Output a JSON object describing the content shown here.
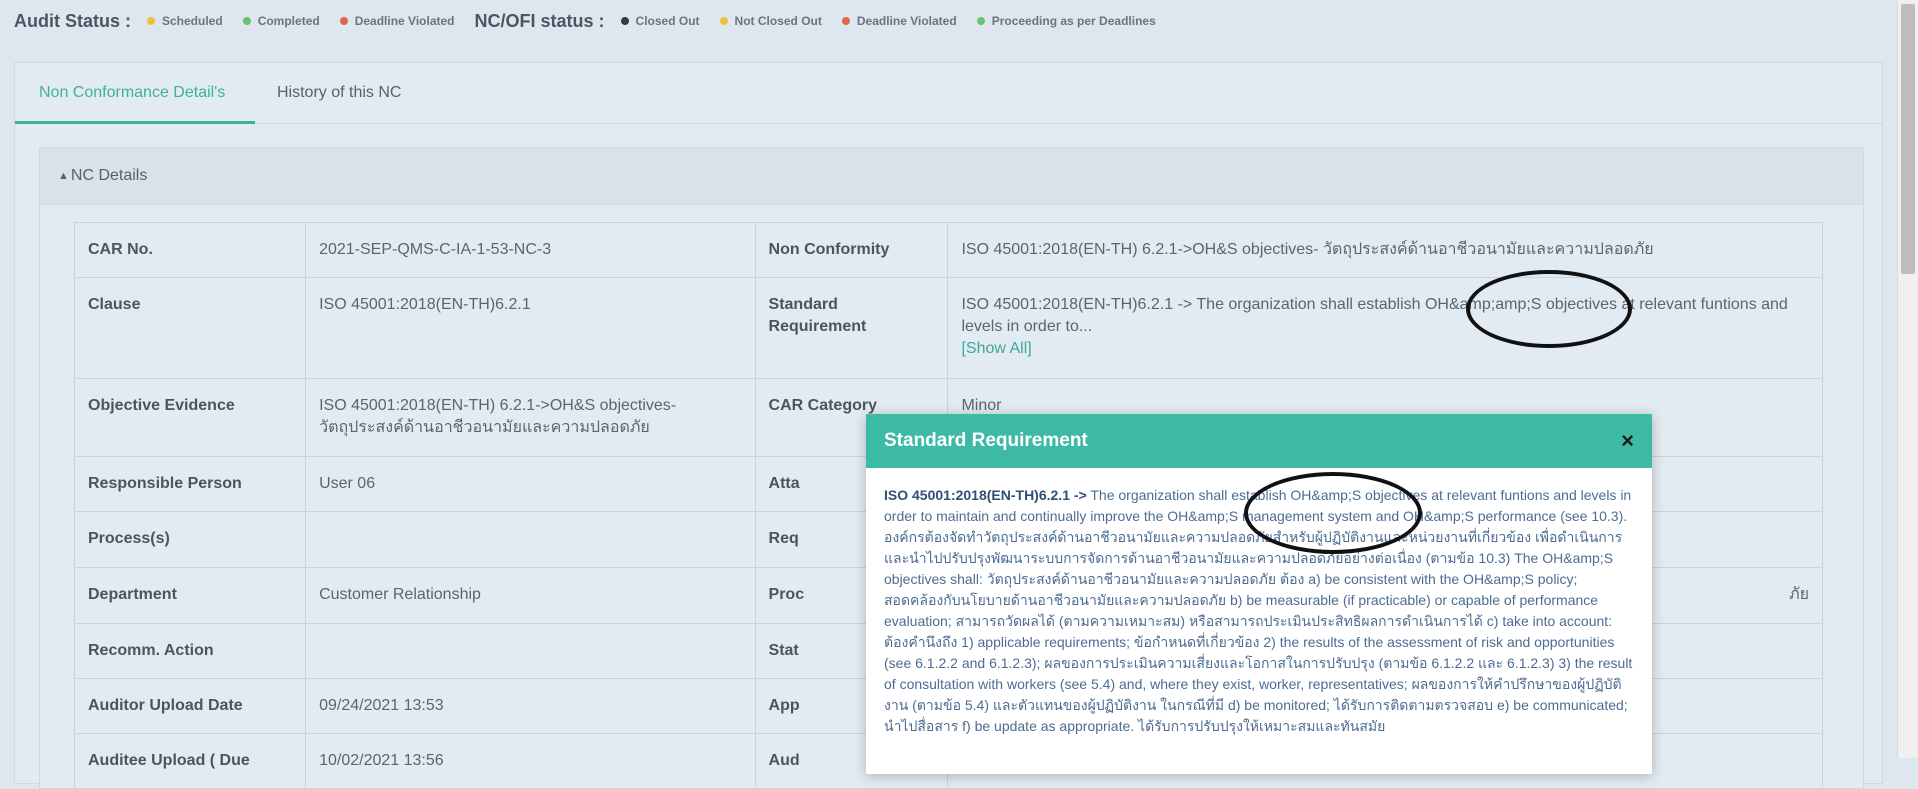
{
  "audit_status": {
    "title": "Audit Status :",
    "items": [
      {
        "label": "Scheduled",
        "color": "#e8c33a"
      },
      {
        "label": "Completed",
        "color": "#6cc071"
      },
      {
        "label": "Deadline Violated",
        "color": "#e0654a"
      }
    ]
  },
  "nc_status": {
    "title": "NC/OFI status :",
    "items": [
      {
        "label": "Closed Out",
        "color": "#333a40"
      },
      {
        "label": "Not Closed Out",
        "color": "#e8c33a"
      },
      {
        "label": "Deadline Violated",
        "color": "#e0654a"
      },
      {
        "label": "Proceeding as per Deadlines",
        "color": "#6cc071"
      }
    ]
  },
  "tabs": {
    "detail": "Non Conformance Detail's",
    "history": "History of this NC"
  },
  "nc_details": {
    "header": "NC Details",
    "rows": {
      "car_no": {
        "label": "CAR No.",
        "value": "2021-SEP-QMS-C-IA-1-53-NC-3"
      },
      "non_conformity": {
        "label": "Non Conformity",
        "value": "ISO 45001:2018(EN-TH) 6.2.1->OH&S objectives- วัตถุประสงค์ด้านอาชีวอนามัยและความปลอดภัย"
      },
      "clause": {
        "label": "Clause",
        "value": "ISO 45001:2018(EN-TH)6.2.1"
      },
      "standard_requirement": {
        "label": "Standard Requirement",
        "value": "ISO 45001:2018(EN-TH)6.2.1 -> The organization shall establish OH&amp;amp;S objectives at relevant funtions and levels in order to...",
        "show_all": "[Show All]"
      },
      "objective_evidence": {
        "label": "Objective Evidence",
        "value": "ISO 45001:2018(EN-TH) 6.2.1->OH&S objectives- วัตถุประสงค์ด้านอาชีวอนามัยและความปลอดภัย"
      },
      "car_category": {
        "label": "CAR Category",
        "value": "Minor"
      },
      "responsible_person": {
        "label": "Responsible Person",
        "value": "User 06"
      },
      "att": {
        "label": "Atta"
      },
      "processes": {
        "label": "Process(s)",
        "value": ""
      },
      "req": {
        "label": "Req"
      },
      "department": {
        "label": "Department",
        "value": "Customer Relationship"
      },
      "proc": {
        "label": "Proc",
        "value": "ภัย"
      },
      "recomm_action": {
        "label": "Recomm. Action",
        "value": ""
      },
      "stat": {
        "label": "Stat"
      },
      "auditor_upload": {
        "label": "Auditor Upload Date",
        "value": "09/24/2021 13:53"
      },
      "app": {
        "label": "App"
      },
      "auditee_upload": {
        "label": "Auditee Upload ( Due",
        "value": "10/02/2021 13:56"
      },
      "aud": {
        "label": "Aud"
      }
    }
  },
  "modal": {
    "title": "Standard Requirement",
    "close": "×",
    "ref": "ISO 45001:2018(EN-TH)6.2.1 ->",
    "body": "The organization shall establish OH&amp;S objectives at relevant funtions and levels in order to maintain and continually improve the OH&amp;S management system and OH&amp;S performance (see 10.3). องค์กรต้องจัดทำวัตถุประสงค์ด้านอาชีวอนามัยและความปลอดภัยสำหรับผู้ปฏิบัติงานและหน่วยงานที่เกี่ยวข้อง เพื่อดำเนินการและนำไปปรับปรุงพัฒนาระบบการจัดการด้านอาชีวอนามัยและความปลอดภัยอย่างต่อเนื่อง (ตามข้อ 10.3) The OH&amp;S objectives shall: วัตถุประสงค์ด้านอาชีวอนามัยและความปลอดภัย ต้อง a) be consistent with the OH&amp;S policy; สอดคล้องกับนโยบายด้านอาชีวอนามัยและความปลอดภัย b) be measurable (if practicable) or capable of performance evaluation; สามารถวัดผลได้ (ตามความเหมาะสม) หรือสามารถประเมินประสิทธิผลการดำเนินการได้ c) take into account: ต้องคำนึงถึง 1) applicable requirements; ข้อกำหนดที่เกี่ยวข้อง 2) the results of the assessment of risk and opportunities (see 6.1.2.2 and 6.1.2.3); ผลของการประเมินความเสี่ยงและโอกาสในการปรับปรุง (ตามข้อ 6.1.2.2 และ 6.1.2.3) 3) the result of consultation with workers (see 5.4) and, where they exist, worker, representatives; ผลของการให้คำปรึกษาของผู้ปฏิบัติงาน (ตามข้อ 5.4) และตัวแทนของผู้ปฏิบัติงาน ในกรณีที่มี d) be monitored; ได้รับการติดตามตรวจสอบ e) be communicated; นำไปสื่อสาร f) be update as appropriate. ได้รับการปรับปรุงให้เหมาะสมและทันสมัย"
  }
}
